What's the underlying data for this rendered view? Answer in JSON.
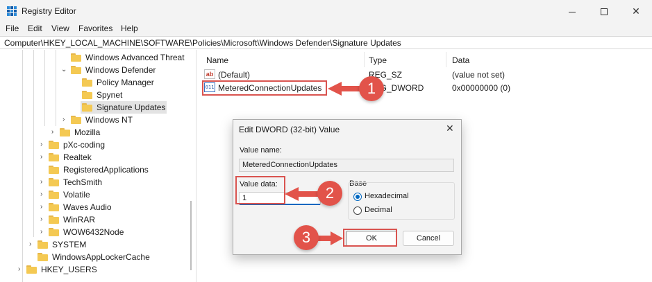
{
  "window": {
    "title": "Registry Editor",
    "min_icon": "minimize-icon",
    "max_icon": "maximize-icon",
    "close_symbol": "✕"
  },
  "menu": [
    "File",
    "Edit",
    "View",
    "Favorites",
    "Help"
  ],
  "address": "Computer\\HKEY_LOCAL_MACHINE\\SOFTWARE\\Policies\\Microsoft\\Windows Defender\\Signature Updates",
  "tree": [
    {
      "label": "Windows Advanced Threat",
      "chevron": "",
      "selected": false
    },
    {
      "label": "Windows Defender",
      "chevron": "⌄",
      "selected": false
    },
    {
      "label": "Policy Manager",
      "chevron": "",
      "selected": false
    },
    {
      "label": "Spynet",
      "chevron": "",
      "selected": false
    },
    {
      "label": "Signature Updates",
      "chevron": "",
      "selected": true
    },
    {
      "label": "Windows NT",
      "chevron": "›",
      "selected": false
    },
    {
      "label": "Mozilla",
      "chevron": "›",
      "selected": false
    },
    {
      "label": "pXc-coding",
      "chevron": "›",
      "selected": false
    },
    {
      "label": "Realtek",
      "chevron": "›",
      "selected": false
    },
    {
      "label": "RegisteredApplications",
      "chevron": "",
      "selected": false
    },
    {
      "label": "TechSmith",
      "chevron": "›",
      "selected": false
    },
    {
      "label": "Volatile",
      "chevron": "›",
      "selected": false
    },
    {
      "label": "Waves Audio",
      "chevron": "›",
      "selected": false
    },
    {
      "label": "WinRAR",
      "chevron": "›",
      "selected": false
    },
    {
      "label": "WOW6432Node",
      "chevron": "›",
      "selected": false
    },
    {
      "label": "SYSTEM",
      "chevron": "›",
      "selected": false
    },
    {
      "label": "WindowsAppLockerCache",
      "chevron": "",
      "selected": false
    },
    {
      "label": "HKEY_USERS",
      "chevron": "›",
      "selected": false
    }
  ],
  "list": {
    "columns": {
      "name": "Name",
      "type": "Type",
      "data": "Data"
    },
    "rows": [
      {
        "icon": "string-value-icon",
        "icon_text": "ab",
        "name": "(Default)",
        "type": "REG_SZ",
        "data": "(value not set)"
      },
      {
        "icon": "binary-value-icon",
        "icon_text": "011",
        "name": "MeteredConnectionUpdates",
        "type": "REG_DWORD",
        "data": "0x00000000 (0)"
      }
    ]
  },
  "dialog": {
    "title": "Edit DWORD (32-bit) Value",
    "close_symbol": "✕",
    "value_name_label": "Value name:",
    "value_name": "MeteredConnectionUpdates",
    "value_data_label": "Value data:",
    "value_data": "1",
    "base_label": "Base",
    "base_options": [
      {
        "label": "Hexadecimal",
        "checked": true
      },
      {
        "label": "Decimal",
        "checked": false
      }
    ],
    "ok_label": "OK",
    "cancel_label": "Cancel"
  },
  "callouts": [
    "1",
    "2",
    "3"
  ],
  "colors": {
    "callout": "#e2534a",
    "highlight": "#d9534f",
    "accent": "#0067c0",
    "folder": "#f4c953"
  }
}
